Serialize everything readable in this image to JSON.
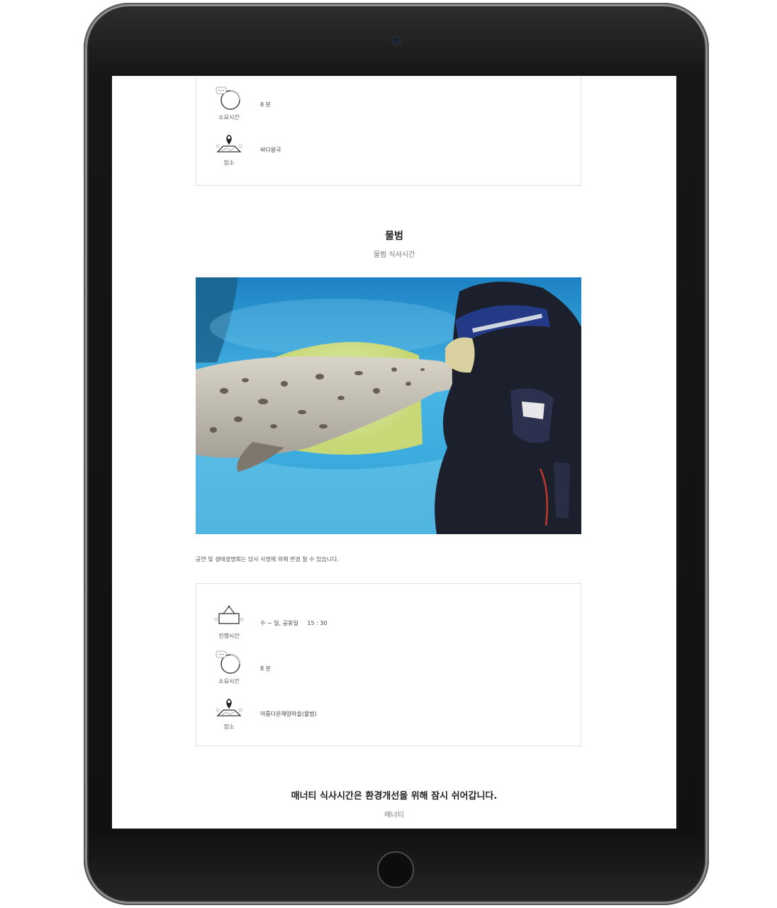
{
  "colors": {
    "device_frame": "#161616",
    "screen_bg": "#ffffff",
    "water": "#3aa8d8",
    "box_border": "#e2e2e2"
  },
  "icons": {
    "duration": "stopwatch-icon",
    "location": "map-pin-icon",
    "schedule": "hanging-sign-icon"
  },
  "top_box": {
    "rows": [
      {
        "label": "소요시간",
        "value": "8 분"
      },
      {
        "label": "장소",
        "value": "바다왕국"
      }
    ]
  },
  "section_seal": {
    "title": "물범",
    "subtitle": "물범 식사시간"
  },
  "notice": "공연 및 생태설명회는 당사 사정에 의해 변경 될 수 있습니다.",
  "seal_box": {
    "rows": [
      {
        "label": "진행시간",
        "value": "수 ~ 일, 공휴일     15 : 30"
      },
      {
        "label": "소요시간",
        "value": "8 분"
      },
      {
        "label": "장소",
        "value": "아름다운해양마을(물범)"
      }
    ]
  },
  "section_manatee": {
    "title": "매너티 식사시간은 환경개선을 위해 잠시 쉬어갑니다.",
    "subtitle": "매너티"
  }
}
